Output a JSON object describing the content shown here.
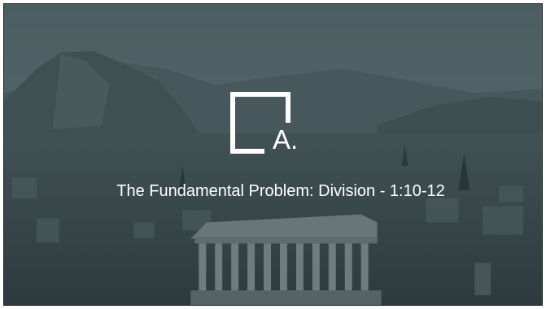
{
  "slide": {
    "section_letter": "A.",
    "title": "The Fundamental Problem: Division - 1:10-12",
    "background_image": "acropolis-athens-cityscape",
    "colors": {
      "overlay": "#3f4f52",
      "text": "#ffffff"
    }
  }
}
